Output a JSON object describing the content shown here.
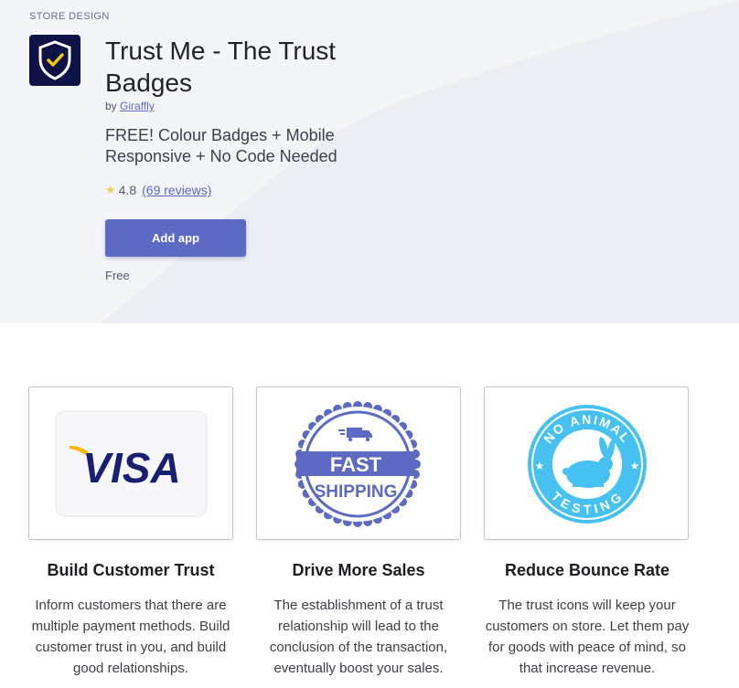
{
  "header": {
    "category": "STORE DESIGN",
    "app_icon": "shield-check-icon",
    "title": "Trust Me - The Trust Badges",
    "by_prefix": "by",
    "developer": "Giraffly",
    "tagline": "FREE! Colour Badges + Mobile Responsive + No Code Needed",
    "rating_icon": "star-icon",
    "rating": "4.8",
    "reviews_link": "(69 reviews)",
    "add_button": "Add app",
    "price": "Free"
  },
  "features": [
    {
      "image": "visa-badge",
      "badge_text": [
        "VISA"
      ],
      "title": "Build Customer Trust",
      "description": "Inform customers that there are multiple payment methods. Build customer trust in you, and build good relationships."
    },
    {
      "image": "fast-shipping-badge",
      "badge_text": [
        "FAST",
        "SHIPPING"
      ],
      "title": "Drive More Sales",
      "description": "The establishment of a trust relationship will lead to the conclusion of the transaction, eventually boost your sales."
    },
    {
      "image": "no-animal-testing-badge",
      "badge_text": [
        "NO ANIMAL",
        "TESTING"
      ],
      "title": "Reduce Bounce Rate",
      "description": "The trust icons will keep your customers on store. Let them pay for goods with peace of mind, so that increase revenue."
    }
  ],
  "colors": {
    "accent": "#5c6ac4",
    "icon_bg": "#0f1246",
    "hero_bg": "#f4f5f9",
    "shipping_badge": "#5c6ac4",
    "animal_badge": "#47c1f1",
    "visa_blue": "#1a1f71",
    "visa_gold": "#f7b600"
  }
}
